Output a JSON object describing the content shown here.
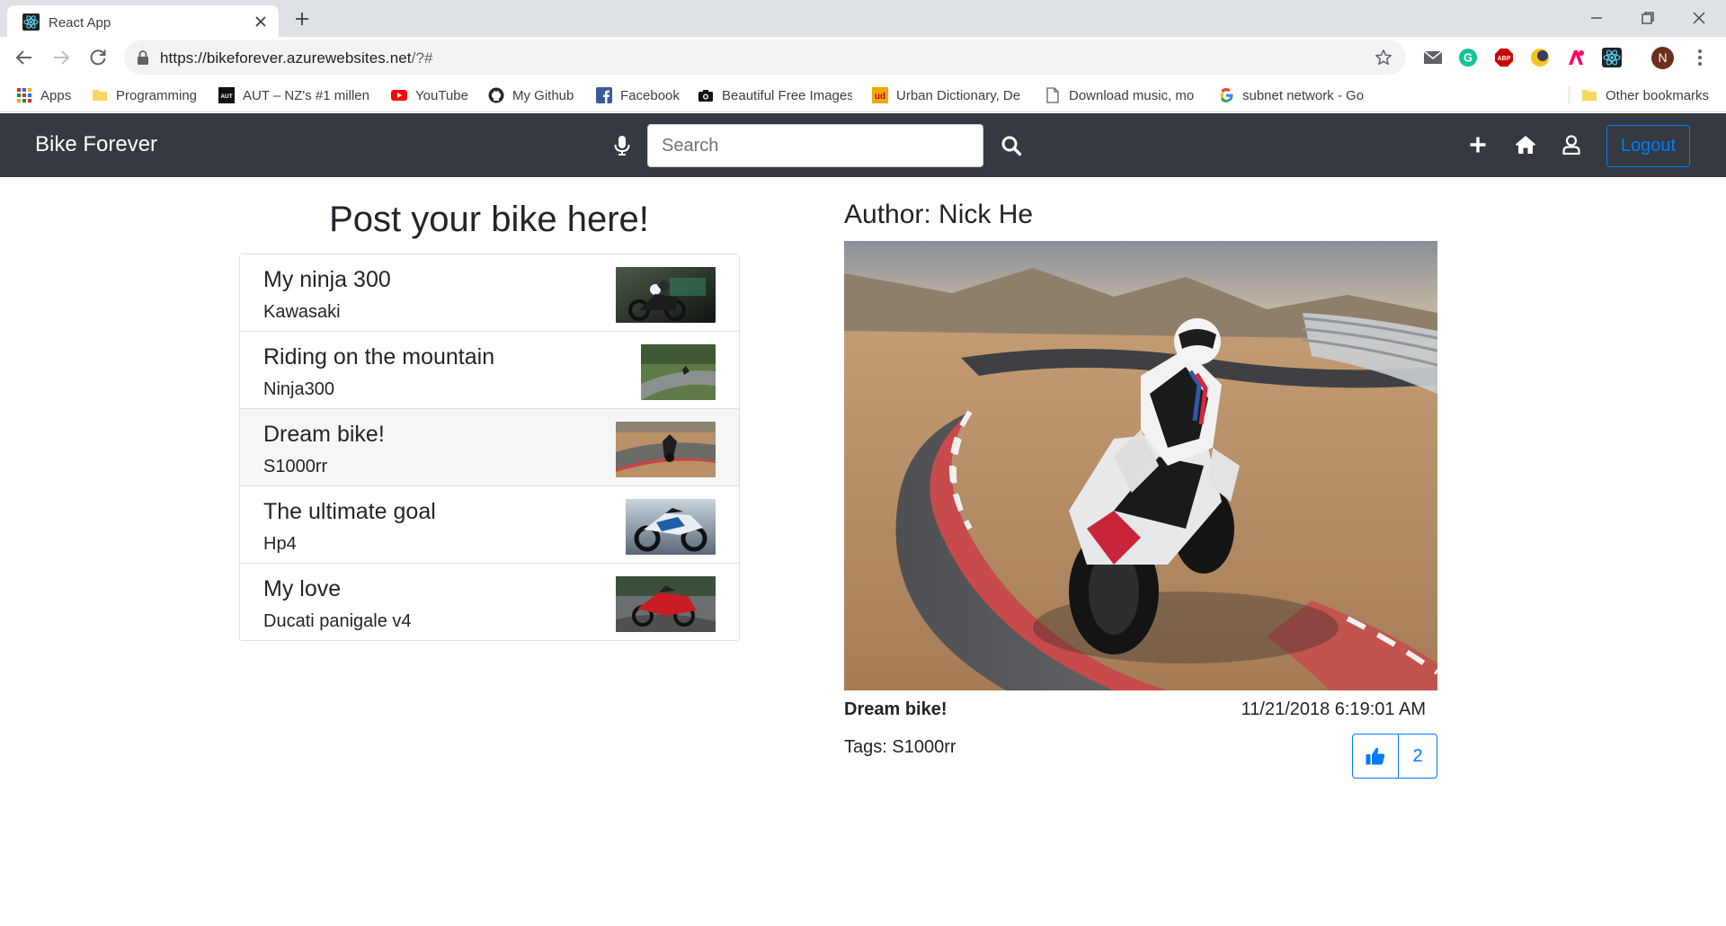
{
  "browser": {
    "tab_title": "React App",
    "url_main": "https://bikeforever.azurewebsites.net",
    "url_rest": "/?#",
    "bookmarks": [
      {
        "label": "Apps",
        "icon": "apps-grid-icon"
      },
      {
        "label": "Programming",
        "icon": "folder-icon"
      },
      {
        "label": "AUT – NZ's #1 millen",
        "icon": "aut-logo-icon"
      },
      {
        "label": "YouTube",
        "icon": "youtube-icon"
      },
      {
        "label": "My Github",
        "icon": "github-icon"
      },
      {
        "label": "Facebook",
        "icon": "facebook-icon"
      },
      {
        "label": "Beautiful Free Images",
        "icon": "camera-icon"
      },
      {
        "label": "Urban Dictionary, De",
        "icon": "urban-dictionary-icon"
      },
      {
        "label": "Download music, mo",
        "icon": "page-icon"
      },
      {
        "label": "subnet network - Go",
        "icon": "google-icon"
      },
      {
        "label": "Other bookmarks",
        "icon": "folder-icon"
      }
    ],
    "profile_initial": "N"
  },
  "navbar": {
    "brand": "Bike Forever",
    "search_placeholder": "Search",
    "logout_label": "Logout"
  },
  "left": {
    "heading": "Post your bike here!",
    "posts": [
      {
        "title": "My ninja 300",
        "subtitle": "Kawasaki",
        "active": false
      },
      {
        "title": "Riding on the mountain",
        "subtitle": "Ninja300",
        "active": false
      },
      {
        "title": "Dream bike!",
        "subtitle": "S1000rr",
        "active": true
      },
      {
        "title": "The ultimate goal",
        "subtitle": "Hp4",
        "active": false
      },
      {
        "title": "My love",
        "subtitle": "Ducati panigale v4",
        "active": false
      }
    ]
  },
  "detail": {
    "author": "Author: Nick He",
    "title": "Dream bike!",
    "timestamp": "11/21/2018 6:19:01 AM",
    "tags": "Tags: S1000rr",
    "likes": "2"
  },
  "colors": {
    "navbar_bg": "#343a40",
    "accent": "#007bff"
  }
}
